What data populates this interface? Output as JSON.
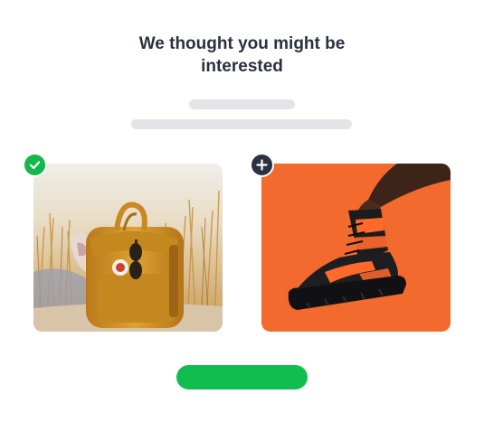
{
  "header": {
    "title_line1": "We thought you might be",
    "title_line2": "interested"
  },
  "products": [
    {
      "name": "backpack",
      "selected": true,
      "badge_icon": "check-icon"
    },
    {
      "name": "sneaker",
      "selected": false,
      "badge_icon": "plus-icon"
    }
  ],
  "cta": {
    "label": ""
  },
  "colors": {
    "title": "#2b3140",
    "skeleton": "#e2e4e8",
    "selected_badge": "#12b84a",
    "add_badge": "#2b3140",
    "cta": "#12bd4f",
    "sneaker_background": "#f26a2e",
    "backpack": "#d99a26"
  }
}
